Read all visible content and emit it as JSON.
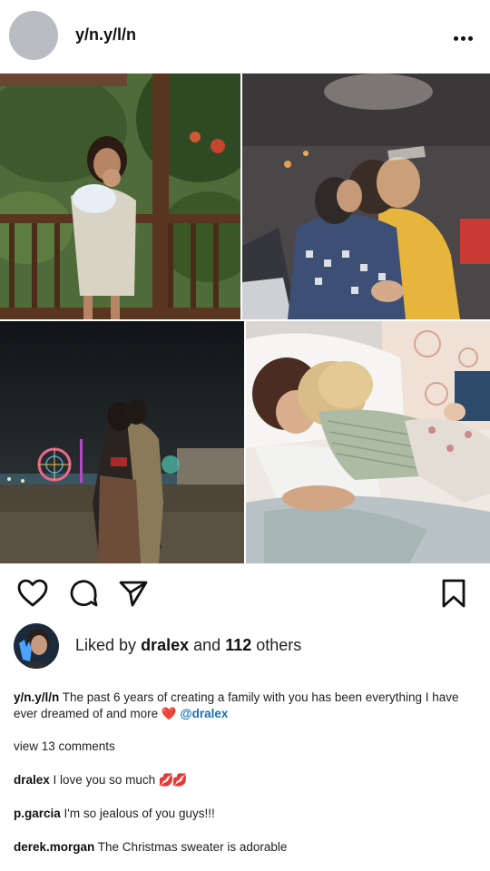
{
  "post": {
    "username": "y/n.y/l/n",
    "images": [
      {
        "description": "mother-holding-baby-on-balcony"
      },
      {
        "description": "couple-kissing-vintage-photo"
      },
      {
        "description": "couple-embracing-at-night-beach"
      },
      {
        "description": "parents-and-children-sleeping"
      }
    ]
  },
  "likes": {
    "prefix": "Liked by",
    "user": "dralex",
    "middle": "and",
    "count": "112",
    "suffix": "others"
  },
  "caption": {
    "username": "y/n.y/l/n",
    "text": "The past 6 years of creating a family with you has been everything I have ever dreamed of and more",
    "emoji": "❤️",
    "mention": "@dralex"
  },
  "view_comments": "view 13 comments",
  "comments": [
    {
      "user": "dralex",
      "text": "I love you so much",
      "emoji": "💋💋"
    },
    {
      "user": "p.garcia",
      "text": "I'm so jealous of you guys!!!",
      "emoji": ""
    },
    {
      "user": "derek.morgan",
      "text": "The Christmas sweater is adorable",
      "emoji": ""
    }
  ],
  "icons": [
    "more-options-icon",
    "heart-icon",
    "comment-icon",
    "share-icon",
    "bookmark-icon"
  ],
  "colors": {
    "mention": "#1a6fb0",
    "heart": "#e0242a",
    "avatar_placeholder": "#b9bcc2"
  }
}
